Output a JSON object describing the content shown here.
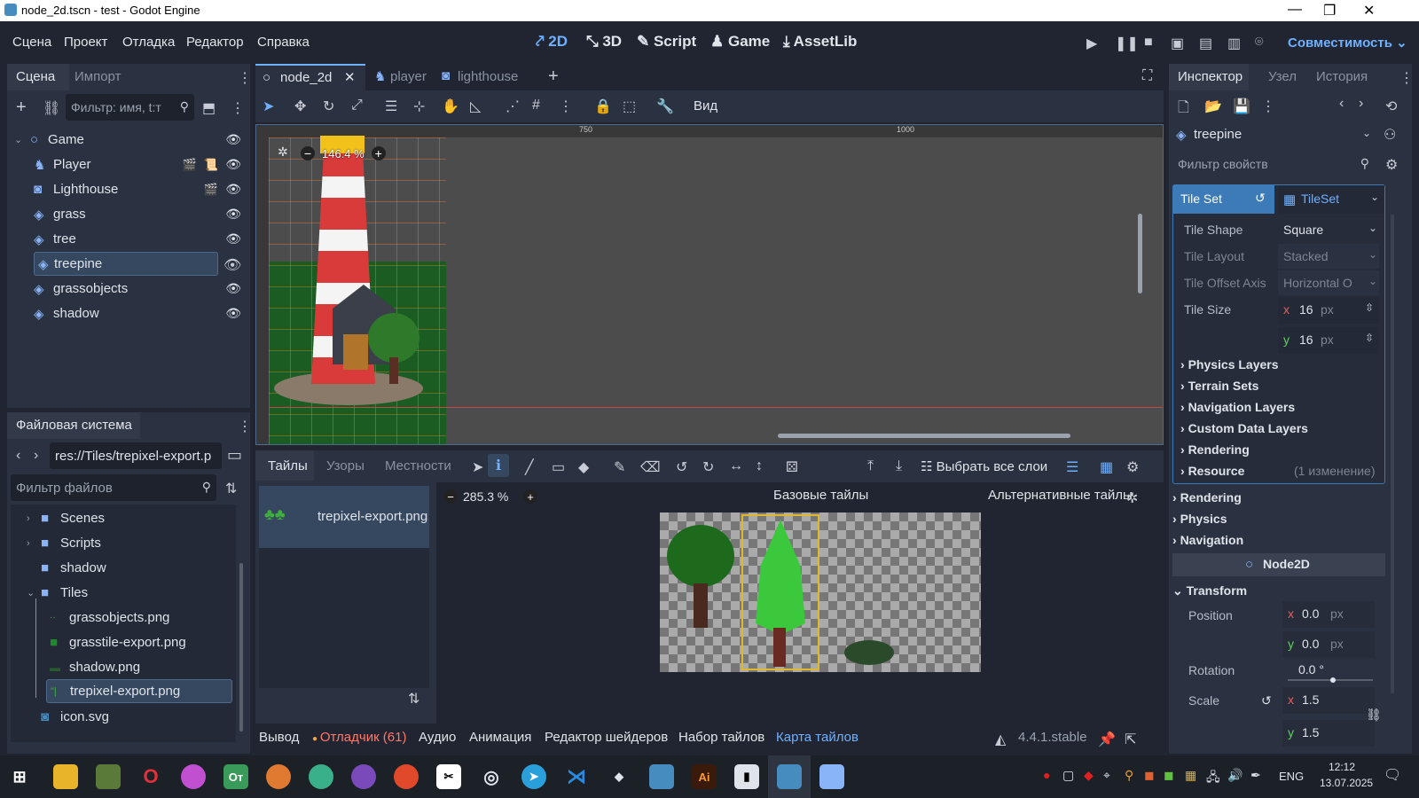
{
  "window": {
    "title": "node_2d.tscn - test - Godot Engine",
    "minimize": "—",
    "maximize": "❐",
    "close": "✕"
  },
  "menu": [
    "Сцена",
    "Проект",
    "Отладка",
    "Редактор",
    "Справка"
  ],
  "workspaces": {
    "w2d": "2D",
    "w3d": "3D",
    "script": "Script",
    "game": "Game",
    "assetlib": "AssetLib"
  },
  "renderer": "Совместимость",
  "scene_dock": {
    "tabs": [
      "Сцена",
      "Импорт"
    ],
    "filter_placeholder": "Фильтр: имя, t:т",
    "nodes": [
      {
        "name": "Game"
      },
      {
        "name": "Player"
      },
      {
        "name": "Lighthouse"
      },
      {
        "name": "grass"
      },
      {
        "name": "tree"
      },
      {
        "name": "treepine"
      },
      {
        "name": "grassobjects"
      },
      {
        "name": "shadow"
      }
    ]
  },
  "filesystem": {
    "title": "Файловая система",
    "path": "res://Tiles/trepixel-export.p",
    "filter_placeholder": "Фильтр файлов",
    "items": [
      {
        "name": "Scenes"
      },
      {
        "name": "Scripts"
      },
      {
        "name": "shadow"
      },
      {
        "name": "Tiles"
      },
      {
        "name": "grassobjects.png"
      },
      {
        "name": "grasstile-export.png"
      },
      {
        "name": "shadow.png"
      },
      {
        "name": "trepixel-export.png"
      },
      {
        "name": "icon.svg"
      }
    ]
  },
  "editor_tabs": [
    "node_2d",
    "player",
    "lighthouse"
  ],
  "toolbar": {
    "view_label": "Вид"
  },
  "viewport": {
    "zoom": "146.4 %",
    "ruler_750": "750",
    "ruler_1000": "1000"
  },
  "tileset_panel": {
    "tabs": [
      "Тайлы",
      "Узоры",
      "Местности"
    ],
    "select_all_layers": "Выбрать все слои",
    "source_name": "trepixel-export.png",
    "zoom": "285.3 %",
    "base_tiles": "Базовые тайлы",
    "alt_tiles": "Альтернативные тайлы"
  },
  "bottom_tabs": [
    "Вывод",
    "Отладчик (61)",
    "Аудио",
    "Анимация",
    "Редактор шейдеров",
    "Набор тайлов",
    "Карта тайлов"
  ],
  "version": "4.4.1.stable",
  "inspector": {
    "tabs": [
      "Инспектор",
      "Узел",
      "История"
    ],
    "node": "treepine",
    "filter_placeholder": "Фильтр свойств",
    "tile_set_label": "Tile Set",
    "tile_set_value": "TileSet",
    "tile_shape_label": "Tile Shape",
    "tile_shape_value": "Square",
    "tile_layout_label": "Tile Layout",
    "tile_layout_value": "Stacked",
    "tile_offset_label": "Tile Offset Axis",
    "tile_offset_value": "Horizontal O",
    "tile_size_label": "Tile Size",
    "tile_size_x": "16",
    "tile_size_y": "16",
    "px": "px",
    "sections": [
      "Physics Layers",
      "Terrain Sets",
      "Navigation Layers",
      "Custom Data Layers",
      "Rendering",
      "Resource"
    ],
    "resource_note": "(1 изменение)",
    "outer_sections": [
      "Rendering",
      "Physics",
      "Navigation"
    ],
    "class_header": "Node2D",
    "transform": "Transform",
    "position_label": "Position",
    "pos_x": "0.0",
    "pos_y": "0.0",
    "rotation_label": "Rotation",
    "rotation_value": "0.0 °",
    "scale_label": "Scale",
    "scale_x": "1.5",
    "scale_y": "1.5",
    "x": "x",
    "y": "y"
  },
  "taskbar": {
    "lang": "ENG",
    "time": "12:12",
    "date": "13.07.2025"
  }
}
